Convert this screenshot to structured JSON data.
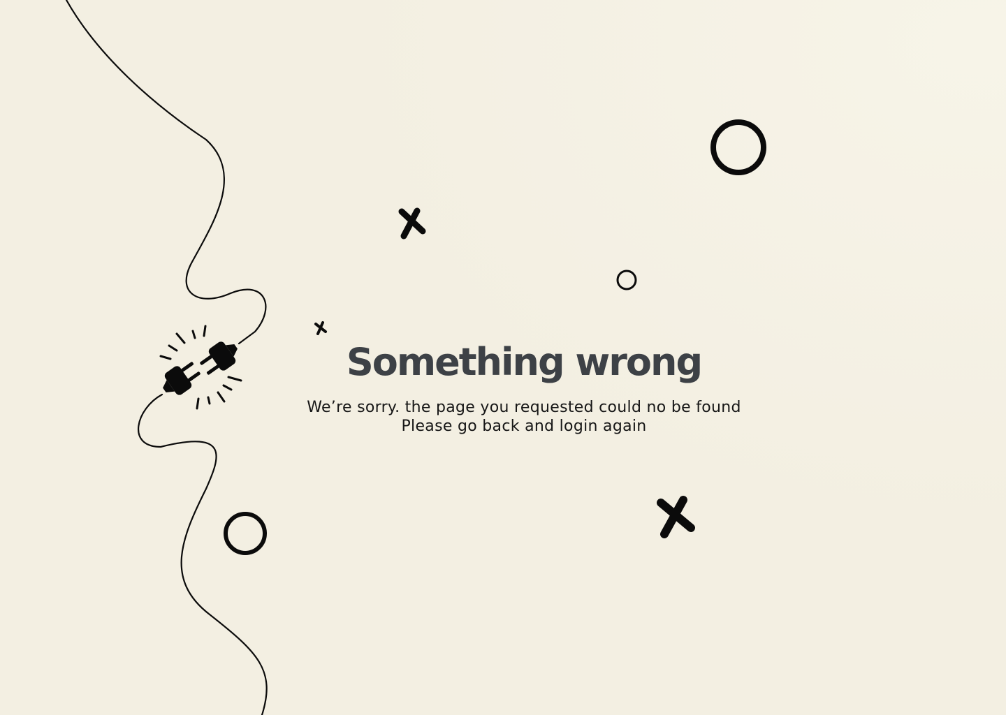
{
  "error": {
    "title": "Something wrong",
    "message_line1": "We’re sorry. the page you requested could no be found",
    "message_line2": "Please go back and login again"
  },
  "illustration": {
    "icon": "unplugged-cable-icon",
    "decorations": [
      "ring-icon",
      "x-mark-icon"
    ]
  },
  "colors": {
    "background": "#f3efe2",
    "title": "#3d4146",
    "text": "#161616",
    "ink": "#0b0b0b"
  }
}
